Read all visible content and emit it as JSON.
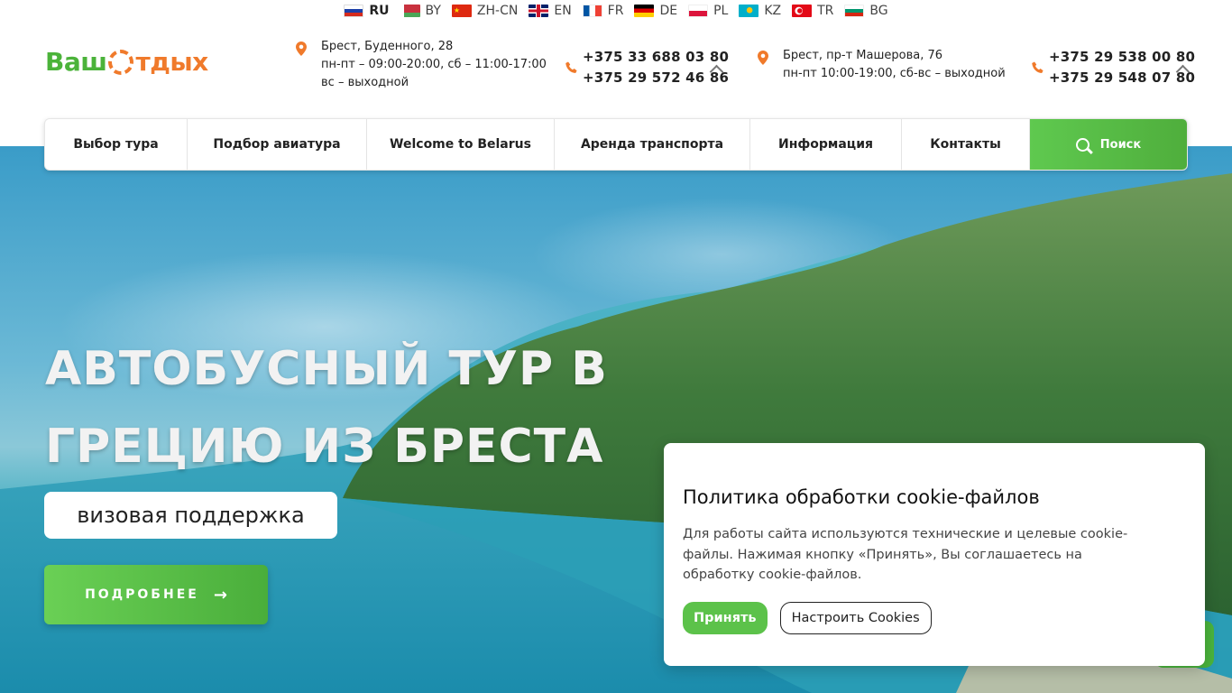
{
  "languages": [
    {
      "code": "RU",
      "active": true
    },
    {
      "code": "BY",
      "active": false
    },
    {
      "code": "ZH-CN",
      "active": false
    },
    {
      "code": "EN",
      "active": false
    },
    {
      "code": "FR",
      "active": false
    },
    {
      "code": "DE",
      "active": false
    },
    {
      "code": "PL",
      "active": false
    },
    {
      "code": "KZ",
      "active": false
    },
    {
      "code": "TR",
      "active": false
    },
    {
      "code": "BG",
      "active": false
    }
  ],
  "logo": {
    "part1": "Ваш",
    "part2": "тдых"
  },
  "office1": {
    "address": "Брест, Буденного, 28",
    "hours1": "пн-пт – 09:00-20:00, сб – 11:00-17:00",
    "hours2": "вс – выходной",
    "phone1": "+375 33 688 03 80",
    "phone2": "+375 29 572 46 86"
  },
  "office2": {
    "address": "Брест, пр-т Машерова, 76",
    "hours1": "пн-пт 10:00-19:00, сб-вс – выходной",
    "phone1": "+375 29 538 00 80",
    "phone2": "+375 29 548 07 80"
  },
  "nav": {
    "items": [
      "Выбор тура",
      "Подбор авиатура",
      "Welcome to Belarus",
      "Аренда транспорта",
      "Информация",
      "Контакты"
    ],
    "search": "Поиск"
  },
  "hero": {
    "title_line1": "АВТОБУСНЫЙ ТУР В",
    "title_line2": "ГРЕЦИЮ ИЗ БРЕСТА",
    "subtitle": "визовая поддержка",
    "button": "ПОДРОБНЕЕ",
    "button_arrow": "→"
  },
  "cookie": {
    "title": "Политика обработки cookie-файлов",
    "text": "Для работы сайта используются технические и целевые cookie-файлы. Нажимая кнопку «Принять», Вы соглашаетесь на обработку cookie-файлов.",
    "accept": "Принять",
    "settings": "Настроить Cookies"
  },
  "colors": {
    "accent_green": "#5cc24a",
    "accent_orange": "#f07a2b"
  }
}
